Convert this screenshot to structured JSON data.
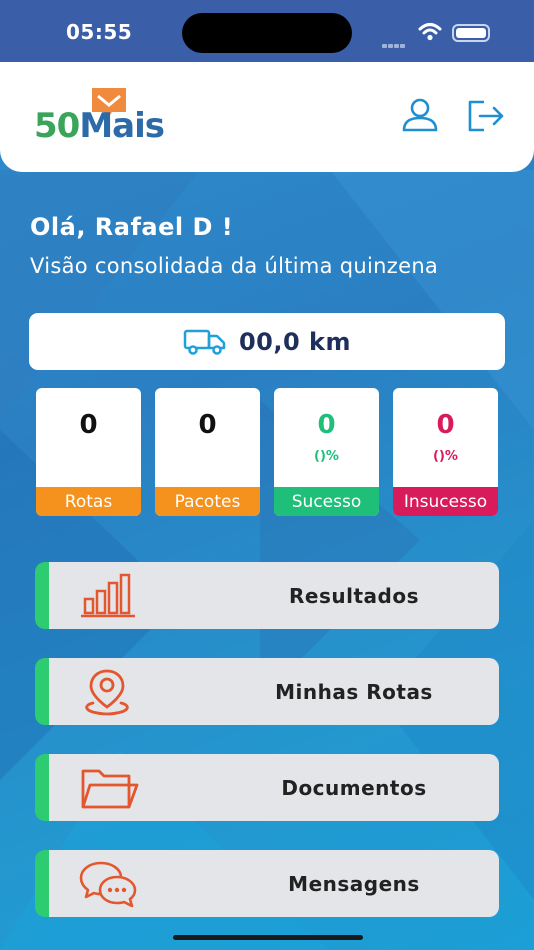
{
  "status_bar": {
    "time": "05:55"
  },
  "header": {
    "logo_number": "50",
    "logo_word": "Mais"
  },
  "greeting": "Olá, Rafael D !",
  "subtitle": "Visão consolidada da última quinzena",
  "distance": {
    "value": "00,0 km",
    "icon": "truck-icon"
  },
  "stats": [
    {
      "value": "0",
      "percent": "",
      "label": "Rotas",
      "color": "#f5921e",
      "text_color": "#111111"
    },
    {
      "value": "0",
      "percent": "",
      "label": "Pacotes",
      "color": "#f5921e",
      "text_color": "#111111"
    },
    {
      "value": "0",
      "percent": "()%",
      "label": "Sucesso",
      "color": "#1fbf7a",
      "text_color": "#1fbf7a"
    },
    {
      "value": "0",
      "percent": "()%",
      "label": "Insucesso",
      "color": "#d81b5a",
      "text_color": "#d81b5a"
    }
  ],
  "menu": [
    {
      "label": "Resultados",
      "icon": "bar-chart-icon"
    },
    {
      "label": "Minhas Rotas",
      "icon": "location-pin-icon"
    },
    {
      "label": "Documentos",
      "icon": "folder-icon"
    },
    {
      "label": "Mensagens",
      "icon": "chat-bubbles-icon"
    }
  ],
  "colors": {
    "accent_orange": "#e4572e",
    "accent_green": "#2ecc71",
    "brand_blue": "#2a86c8"
  }
}
